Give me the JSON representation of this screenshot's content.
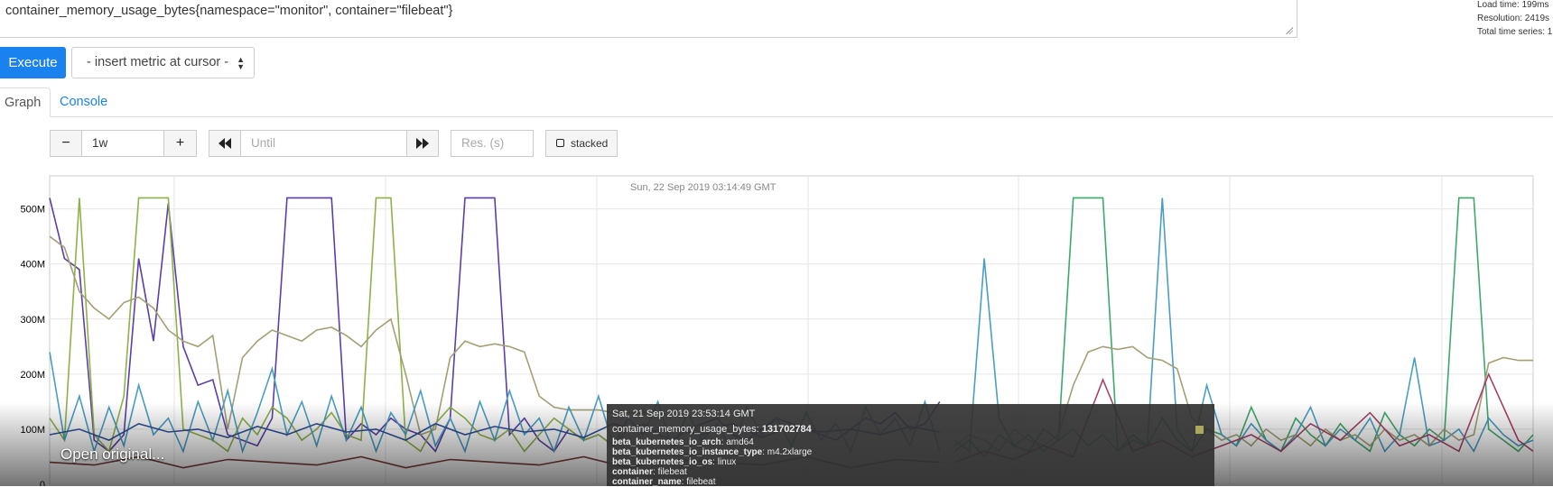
{
  "query": {
    "expression": "container_memory_usage_bytes{namespace=\"monitor\", container=\"filebeat\"}"
  },
  "stats": {
    "load_time": "Load time: 199ms",
    "resolution": "Resolution: 2419s",
    "total_series": "Total time series: 1"
  },
  "toolbar": {
    "execute_label": "Execute",
    "metric_select_value": "- insert metric at cursor -"
  },
  "tabs": [
    {
      "label": "Graph",
      "active": true
    },
    {
      "label": "Console",
      "active": false
    }
  ],
  "graph_controls": {
    "range_minus": "−",
    "range_value": "1w",
    "range_plus": "+",
    "until_placeholder": "Until",
    "res_placeholder": "Res. (s)",
    "stacked_label": "stacked"
  },
  "hover_time": "Sun, 22 Sep 2019 03:14:49 GMT",
  "overlay": {
    "open_original": "Open original..."
  },
  "tooltip": {
    "date": "Sat, 21 Sep 2019 23:53:14 GMT",
    "metric_name": "container_memory_usage_bytes:",
    "metric_value": "131702784",
    "labels": [
      {
        "key": "beta_kubernetes_io_arch",
        "value": "amd64"
      },
      {
        "key": "beta_kubernetes_io_instance_type",
        "value": "m4.2xlarge"
      },
      {
        "key": "beta_kubernetes_io_os",
        "value": "linux"
      },
      {
        "key": "container",
        "value": "filebeat"
      },
      {
        "key": "container_name",
        "value": "filebeat"
      }
    ]
  },
  "colors": {
    "accent": "#1a82ee",
    "grid": "#e6e6e6"
  },
  "chart_data": {
    "type": "line",
    "y_ticks": [
      "0",
      "100M",
      "200M",
      "300M",
      "400M",
      "500M"
    ],
    "ylim": [
      0,
      560000000
    ],
    "xlim": [
      0,
      100
    ],
    "grid": true,
    "series": [
      {
        "color": "#5b3fa6",
        "x": [
          0,
          1,
          2,
          3,
          4,
          5,
          6,
          7,
          8,
          9,
          10,
          11,
          12,
          13,
          14,
          15,
          16,
          17,
          18,
          19,
          20,
          21,
          22,
          23,
          24,
          25,
          26,
          27,
          28,
          29,
          30,
          31,
          32,
          33,
          34,
          35,
          36,
          37,
          38,
          39,
          40,
          41,
          42,
          43,
          44,
          45,
          46,
          47,
          48,
          49,
          50,
          51,
          52,
          53,
          54,
          55,
          56,
          57,
          58,
          59,
          60
        ],
        "y": [
          520,
          410,
          390,
          80,
          60,
          90,
          410,
          260,
          510,
          250,
          180,
          190,
          90,
          80,
          70,
          120,
          520,
          520,
          520,
          520,
          80,
          110,
          90,
          120,
          100,
          90,
          60,
          120,
          520,
          520,
          520,
          90,
          120,
          80,
          60,
          100,
          80,
          90,
          70,
          100,
          110,
          90,
          80,
          100,
          110,
          120,
          90,
          80,
          100,
          120,
          110,
          100,
          90,
          80,
          100,
          120,
          110,
          130,
          100,
          110,
          150
        ]
      },
      {
        "color": "#8fb04a",
        "x": [
          0,
          1,
          2,
          3,
          4,
          5,
          6,
          7,
          8,
          9,
          10,
          11,
          12,
          13,
          14,
          15,
          16,
          17,
          18,
          19,
          20,
          21,
          22,
          23,
          24,
          25,
          26,
          27,
          28,
          29,
          30,
          31,
          32,
          33,
          34,
          35,
          36,
          37,
          38,
          39,
          40
        ],
        "y": [
          120,
          80,
          520,
          90,
          60,
          160,
          520,
          520,
          520,
          100,
          90,
          80,
          60,
          120,
          90,
          140,
          120,
          80,
          100,
          130,
          90,
          80,
          520,
          520,
          80,
          60,
          110,
          140,
          120,
          90,
          80,
          100,
          60,
          90,
          120,
          100,
          80,
          90,
          70,
          100,
          110
        ]
      },
      {
        "color": "#a3a074",
        "x": [
          0,
          1,
          2,
          3,
          4,
          5,
          6,
          7,
          8,
          9,
          10,
          11,
          12,
          13,
          14,
          15,
          16,
          17,
          18,
          19,
          20,
          21,
          22,
          23,
          24,
          25,
          26,
          27,
          28,
          29,
          30,
          31,
          32,
          33,
          34,
          35,
          36,
          37,
          38,
          39,
          40
        ],
        "y": [
          450,
          430,
          350,
          320,
          300,
          330,
          340,
          320,
          280,
          260,
          250,
          270,
          100,
          230,
          260,
          280,
          270,
          260,
          280,
          285,
          270,
          250,
          280,
          300,
          200,
          90,
          100,
          230,
          260,
          250,
          255,
          250,
          240,
          160,
          140,
          135,
          135,
          135,
          130,
          130,
          130
        ]
      },
      {
        "color": "#4a9ec2",
        "x": [
          0,
          1,
          2,
          3,
          4,
          5,
          6,
          7,
          8,
          9,
          10,
          11,
          12,
          13,
          14,
          15,
          16,
          17,
          18,
          19,
          20,
          21,
          22,
          23,
          24,
          25,
          26,
          27,
          28,
          29,
          30,
          31,
          32,
          33,
          34,
          35,
          36,
          37,
          38,
          39,
          40,
          41,
          42,
          43,
          44,
          45,
          46,
          47,
          48,
          49,
          50,
          51,
          52,
          53,
          54,
          55,
          56,
          57,
          58,
          59,
          60
        ],
        "y": [
          240,
          80,
          160,
          60,
          140,
          70,
          180,
          90,
          120,
          60,
          150,
          80,
          170,
          60,
          130,
          210,
          90,
          150,
          70,
          160,
          80,
          140,
          60,
          130,
          90,
          170,
          70,
          120,
          60,
          150,
          80,
          170,
          90,
          120,
          60,
          140,
          80,
          160,
          70,
          120,
          90,
          150,
          60,
          130,
          80,
          110,
          60,
          140,
          90,
          120,
          70,
          130,
          80,
          110,
          60,
          140,
          90,
          120,
          70,
          150,
          60
        ]
      },
      {
        "color": "#2f4f9a",
        "x": [
          0,
          2,
          4,
          6,
          8,
          10,
          12,
          14,
          16,
          18,
          20,
          22,
          24,
          26,
          28,
          30,
          32,
          34,
          36,
          38,
          40,
          42,
          44,
          46,
          48,
          50,
          52,
          54,
          56,
          58,
          60
        ],
        "y": [
          90,
          100,
          80,
          110,
          95,
          100,
          85,
          105,
          90,
          110,
          95,
          100,
          80,
          110,
          90,
          105,
          95,
          100,
          85,
          110,
          95,
          100,
          90,
          110,
          85,
          105,
          95,
          100,
          90,
          105,
          95
        ]
      },
      {
        "color": "#7a3b3b",
        "x": [
          0,
          3,
          6,
          9,
          12,
          15,
          18,
          21,
          24,
          27,
          30,
          33,
          36,
          39,
          42,
          45,
          48,
          51,
          54,
          57,
          60
        ],
        "y": [
          40,
          35,
          50,
          30,
          45,
          40,
          35,
          50,
          30,
          45,
          40,
          35,
          50,
          30,
          45,
          40,
          35,
          50,
          30,
          45,
          40
        ]
      },
      {
        "color": "#3fa86b",
        "x": [
          61,
          62,
          63,
          64,
          65,
          66,
          67,
          68,
          69,
          70,
          71,
          72,
          73,
          74,
          75,
          76,
          77,
          78,
          79,
          80,
          81,
          82,
          83,
          84,
          85,
          86,
          87,
          88,
          89,
          90,
          91,
          92,
          93,
          94,
          95,
          96,
          97,
          98,
          99,
          100
        ],
        "y": [
          60,
          80,
          50,
          90,
          70,
          60,
          100,
          80,
          520,
          520,
          520,
          60,
          90,
          70,
          120,
          80,
          60,
          100,
          90,
          70,
          140,
          80,
          60,
          120,
          90,
          70,
          110,
          80,
          60,
          130,
          90,
          70,
          100,
          80,
          520,
          520,
          100,
          80,
          60,
          90
        ]
      },
      {
        "color": "#4a9ec2",
        "x": [
          61,
          62,
          63,
          64,
          65,
          66,
          67,
          68,
          69,
          70,
          71,
          72,
          73,
          74,
          75,
          76,
          77,
          78,
          79,
          80,
          81,
          82,
          83,
          84,
          85,
          86,
          87,
          88,
          89,
          90,
          91,
          92,
          93,
          94,
          95,
          96,
          97,
          98,
          99,
          100
        ],
        "y": [
          80,
          60,
          410,
          120,
          70,
          90,
          60,
          80,
          100,
          70,
          90,
          60,
          80,
          70,
          520,
          100,
          60,
          180,
          90,
          70,
          110,
          80,
          60,
          90,
          140,
          70,
          100,
          80,
          120,
          60,
          90,
          230,
          70,
          80,
          100,
          60,
          120,
          90,
          70,
          80
        ]
      },
      {
        "color": "#a3a074",
        "x": [
          61,
          62,
          63,
          64,
          65,
          66,
          67,
          68,
          69,
          70,
          71,
          72,
          73,
          74,
          75,
          76,
          77,
          78,
          79,
          80,
          81,
          82,
          83,
          84,
          85,
          86,
          87,
          88,
          89,
          90,
          91,
          92,
          93,
          94,
          95,
          96,
          97,
          98,
          99,
          100
        ],
        "y": [
          70,
          90,
          80,
          60,
          100,
          80,
          70,
          90,
          180,
          240,
          250,
          245,
          250,
          230,
          225,
          210,
          120,
          100,
          80,
          90,
          70,
          100,
          80,
          90,
          70,
          100,
          80,
          90,
          70,
          100,
          80,
          90,
          70,
          100,
          80,
          90,
          220,
          230,
          225,
          225
        ]
      },
      {
        "color": "#a8416a",
        "x": [
          61,
          63,
          65,
          67,
          69,
          71,
          73,
          75,
          77,
          79,
          81,
          83,
          85,
          87,
          89,
          91,
          93,
          95,
          97,
          99,
          100
        ],
        "y": [
          40,
          60,
          45,
          70,
          50,
          190,
          60,
          80,
          50,
          70,
          90,
          60,
          110,
          80,
          130,
          70,
          90,
          60,
          200,
          80,
          60
        ]
      }
    ]
  }
}
